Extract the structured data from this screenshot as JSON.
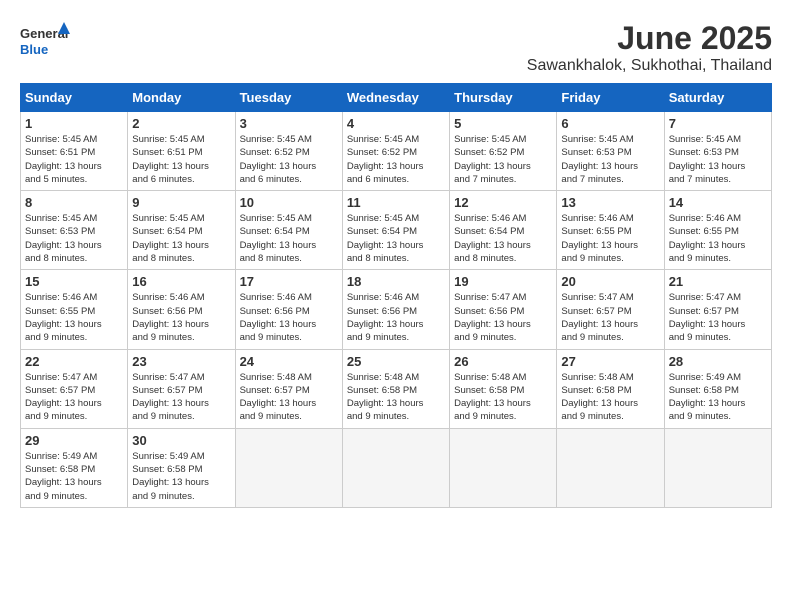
{
  "header": {
    "logo_general": "General",
    "logo_blue": "Blue",
    "title": "June 2025",
    "subtitle": "Sawankhalok, Sukhothai, Thailand"
  },
  "days": [
    "Sunday",
    "Monday",
    "Tuesday",
    "Wednesday",
    "Thursday",
    "Friday",
    "Saturday"
  ],
  "weeks": [
    [
      {
        "day": "1",
        "info": "Sunrise: 5:45 AM\nSunset: 6:51 PM\nDaylight: 13 hours\nand 5 minutes."
      },
      {
        "day": "2",
        "info": "Sunrise: 5:45 AM\nSunset: 6:51 PM\nDaylight: 13 hours\nand 6 minutes."
      },
      {
        "day": "3",
        "info": "Sunrise: 5:45 AM\nSunset: 6:52 PM\nDaylight: 13 hours\nand 6 minutes."
      },
      {
        "day": "4",
        "info": "Sunrise: 5:45 AM\nSunset: 6:52 PM\nDaylight: 13 hours\nand 6 minutes."
      },
      {
        "day": "5",
        "info": "Sunrise: 5:45 AM\nSunset: 6:52 PM\nDaylight: 13 hours\nand 7 minutes."
      },
      {
        "day": "6",
        "info": "Sunrise: 5:45 AM\nSunset: 6:53 PM\nDaylight: 13 hours\nand 7 minutes."
      },
      {
        "day": "7",
        "info": "Sunrise: 5:45 AM\nSunset: 6:53 PM\nDaylight: 13 hours\nand 7 minutes."
      }
    ],
    [
      {
        "day": "8",
        "info": "Sunrise: 5:45 AM\nSunset: 6:53 PM\nDaylight: 13 hours\nand 8 minutes."
      },
      {
        "day": "9",
        "info": "Sunrise: 5:45 AM\nSunset: 6:54 PM\nDaylight: 13 hours\nand 8 minutes."
      },
      {
        "day": "10",
        "info": "Sunrise: 5:45 AM\nSunset: 6:54 PM\nDaylight: 13 hours\nand 8 minutes."
      },
      {
        "day": "11",
        "info": "Sunrise: 5:45 AM\nSunset: 6:54 PM\nDaylight: 13 hours\nand 8 minutes."
      },
      {
        "day": "12",
        "info": "Sunrise: 5:46 AM\nSunset: 6:54 PM\nDaylight: 13 hours\nand 8 minutes."
      },
      {
        "day": "13",
        "info": "Sunrise: 5:46 AM\nSunset: 6:55 PM\nDaylight: 13 hours\nand 9 minutes."
      },
      {
        "day": "14",
        "info": "Sunrise: 5:46 AM\nSunset: 6:55 PM\nDaylight: 13 hours\nand 9 minutes."
      }
    ],
    [
      {
        "day": "15",
        "info": "Sunrise: 5:46 AM\nSunset: 6:55 PM\nDaylight: 13 hours\nand 9 minutes."
      },
      {
        "day": "16",
        "info": "Sunrise: 5:46 AM\nSunset: 6:56 PM\nDaylight: 13 hours\nand 9 minutes."
      },
      {
        "day": "17",
        "info": "Sunrise: 5:46 AM\nSunset: 6:56 PM\nDaylight: 13 hours\nand 9 minutes."
      },
      {
        "day": "18",
        "info": "Sunrise: 5:46 AM\nSunset: 6:56 PM\nDaylight: 13 hours\nand 9 minutes."
      },
      {
        "day": "19",
        "info": "Sunrise: 5:47 AM\nSunset: 6:56 PM\nDaylight: 13 hours\nand 9 minutes."
      },
      {
        "day": "20",
        "info": "Sunrise: 5:47 AM\nSunset: 6:57 PM\nDaylight: 13 hours\nand 9 minutes."
      },
      {
        "day": "21",
        "info": "Sunrise: 5:47 AM\nSunset: 6:57 PM\nDaylight: 13 hours\nand 9 minutes."
      }
    ],
    [
      {
        "day": "22",
        "info": "Sunrise: 5:47 AM\nSunset: 6:57 PM\nDaylight: 13 hours\nand 9 minutes."
      },
      {
        "day": "23",
        "info": "Sunrise: 5:47 AM\nSunset: 6:57 PM\nDaylight: 13 hours\nand 9 minutes."
      },
      {
        "day": "24",
        "info": "Sunrise: 5:48 AM\nSunset: 6:57 PM\nDaylight: 13 hours\nand 9 minutes."
      },
      {
        "day": "25",
        "info": "Sunrise: 5:48 AM\nSunset: 6:58 PM\nDaylight: 13 hours\nand 9 minutes."
      },
      {
        "day": "26",
        "info": "Sunrise: 5:48 AM\nSunset: 6:58 PM\nDaylight: 13 hours\nand 9 minutes."
      },
      {
        "day": "27",
        "info": "Sunrise: 5:48 AM\nSunset: 6:58 PM\nDaylight: 13 hours\nand 9 minutes."
      },
      {
        "day": "28",
        "info": "Sunrise: 5:49 AM\nSunset: 6:58 PM\nDaylight: 13 hours\nand 9 minutes."
      }
    ],
    [
      {
        "day": "29",
        "info": "Sunrise: 5:49 AM\nSunset: 6:58 PM\nDaylight: 13 hours\nand 9 minutes."
      },
      {
        "day": "30",
        "info": "Sunrise: 5:49 AM\nSunset: 6:58 PM\nDaylight: 13 hours\nand 9 minutes."
      },
      {
        "day": "",
        "info": ""
      },
      {
        "day": "",
        "info": ""
      },
      {
        "day": "",
        "info": ""
      },
      {
        "day": "",
        "info": ""
      },
      {
        "day": "",
        "info": ""
      }
    ]
  ]
}
